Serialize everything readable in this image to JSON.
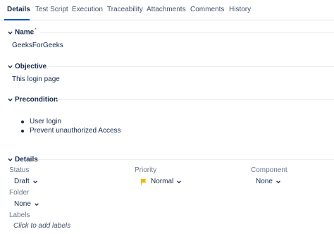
{
  "tabs": [
    "Details",
    "Test Script",
    "Execution",
    "Traceability",
    "Attachments",
    "Comments",
    "History"
  ],
  "active_tab": "Details",
  "name_section": {
    "title": "Name",
    "required_mark": "*",
    "value": "GeeksForGeeks"
  },
  "objective_section": {
    "title": "Objective",
    "value": "This login page"
  },
  "precondition_section": {
    "title": "Precondition",
    "items": [
      "User login",
      "Prevent unauthorized  Access"
    ]
  },
  "details_section": {
    "title": "Details",
    "status": {
      "label": "Status",
      "value": "Draft"
    },
    "priority": {
      "label": "Priority",
      "value": "Normal",
      "flag_color": "#f6b600"
    },
    "component": {
      "label": "Component",
      "value": "None"
    },
    "folder": {
      "label": "Folder",
      "value": "None"
    },
    "labels": {
      "label": "Labels",
      "placeholder": "Click to add labels"
    }
  },
  "colors": {
    "accent": "#0052cc",
    "text": "#172b4d",
    "muted": "#6b778c"
  }
}
